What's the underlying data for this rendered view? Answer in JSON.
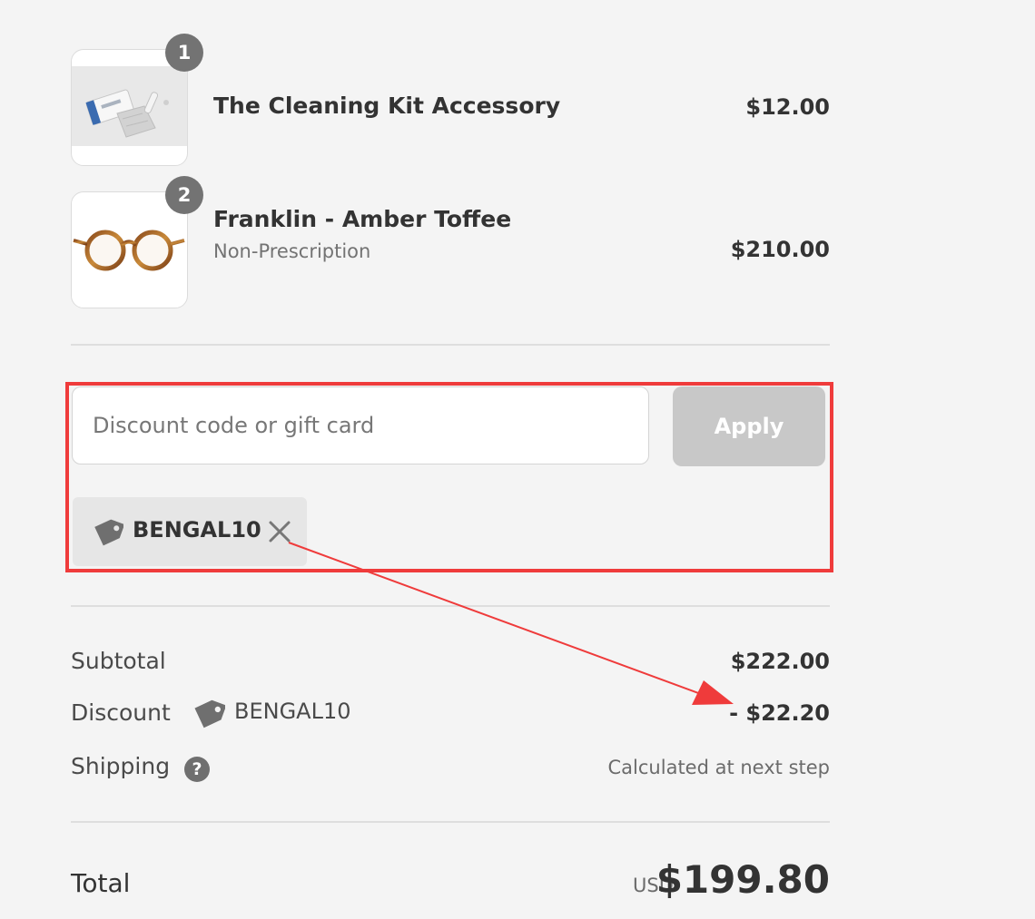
{
  "line_items": [
    {
      "quantity": "1",
      "name": "The Cleaning Kit Accessory",
      "variant": "",
      "price": "$12.00",
      "image_icon": "cleaning-kit-image"
    },
    {
      "quantity": "2",
      "name": "Franklin - Amber Toffee",
      "variant": "Non-Prescription",
      "price": "$210.00",
      "image_icon": "glasses-image"
    }
  ],
  "discount": {
    "placeholder": "Discount code or gift card",
    "value": "",
    "apply_label": "Apply",
    "applied_code": "BENGAL10",
    "tag_icon": "tag-icon",
    "remove_icon": "close-icon"
  },
  "summary": {
    "subtotal_label": "Subtotal",
    "subtotal_value": "$222.00",
    "discount_label": "Discount",
    "discount_code": "BENGAL10",
    "discount_value": "- $22.20",
    "shipping_label": "Shipping",
    "shipping_help": "?",
    "shipping_value": "Calculated at next step",
    "total_label": "Total",
    "currency": "USD",
    "total_value": "$199.80"
  },
  "colors": {
    "highlight": "#ef3b3b",
    "apply_button": "#c8c8c8",
    "badge": "#737373",
    "background": "#f4f4f4"
  }
}
